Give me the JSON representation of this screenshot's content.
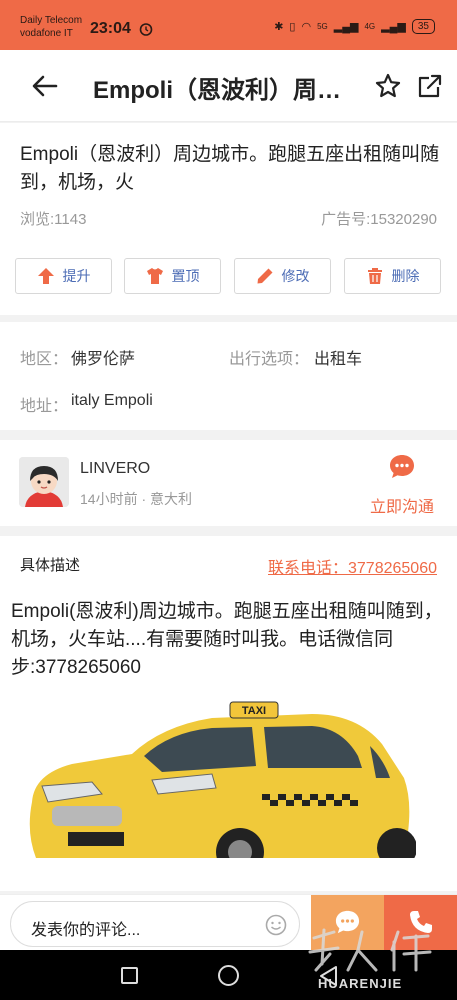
{
  "status_bar": {
    "carrier_1": "Daily Telecom",
    "carrier_2": "vodafone IT",
    "time": "23:04",
    "battery": "35",
    "network_1": "5G",
    "network_2": "4G"
  },
  "header": {
    "title": "Empoli（恩波利）周边城市。跑腿五座出租随叫随到，机场，火"
  },
  "listing": {
    "title": "Empoli（恩波利）周边城市。跑腿五座出租随叫随到，机场，火",
    "views": "浏览:1143",
    "ad_id": "广告号:15320290",
    "actions": [
      {
        "label": "提升",
        "icon": "arrow-up-icon"
      },
      {
        "label": "置顶",
        "icon": "shirt-icon"
      },
      {
        "label": "修改",
        "icon": "pencil-icon"
      },
      {
        "label": "删除",
        "icon": "trash-icon"
      }
    ]
  },
  "info": {
    "region_label": "地区：",
    "region_value": "佛罗伦萨",
    "travel_label": "出行选项：",
    "travel_value": "出租车",
    "address_label": "地址：",
    "address_value": "italy Empoli"
  },
  "poster": {
    "name": "LINVERO",
    "meta": "14小时前 · 意大利",
    "chat_label": "立即沟通"
  },
  "description": {
    "heading": "具体描述",
    "phone_link": "联系电话：3778265060",
    "body": "Empoli(恩波利)周边城市。跑腿五座出租随叫随到，机场，火车站....有需要随时叫我。电话微信同步:3778265060",
    "taxi_sign": "TAXI"
  },
  "comment_bar": {
    "placeholder": "发表你的评论..."
  },
  "watermark": {
    "text": "HUARENJIE"
  },
  "colors": {
    "brand": "#ef6a47",
    "secondary": "#f3a45f",
    "action_text": "#4c6cb5"
  }
}
